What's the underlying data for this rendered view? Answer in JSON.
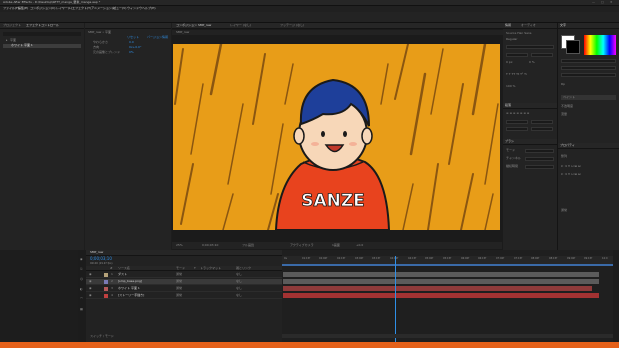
{
  "window": {
    "title": "Adobe After Effects - D:\\Desktop\\SETT_manga_要素_manga.aep *"
  },
  "menu": [
    "ファイル(F)",
    "編集(E)",
    "コンポジション(C)",
    "レイヤー(L)",
    "エフェクト(T)",
    "アニメーション(A)",
    "ビュー(V)",
    "ウィンドウ",
    "ヘルプ(H)"
  ],
  "toolbar": {
    "workspaces": [
      "デフォルト",
      "学ぶ",
      "標準",
      "小画面",
      "ライブラリ"
    ],
    "search_placeholder": "ヘルプを検索"
  },
  "project_panel": {
    "tab": "プロジェクト",
    "tab2": "エフェクトコントロール",
    "items": [
      "平面",
      "ホワイト 平面 1"
    ]
  },
  "effect_controls": {
    "layer": "SMP_raw • 平面",
    "rows": [
      {
        "label": "やわらかさ",
        "value": "0.0"
      },
      {
        "label": "方向",
        "value": "0x+0.0°"
      },
      {
        "label": "元の画像とブレンド",
        "value": "0%"
      }
    ],
    "reset": "リセット",
    "about": "バージョン情報"
  },
  "viewer": {
    "tabs": [
      "コンポジション SMP_raw",
      "レイヤー (なし)",
      "フッテージ (なし)"
    ],
    "breadcrumb": "SMP_raw",
    "shirt_text": "SANZE",
    "controls": {
      "zoom": "25%",
      "timecode": "0;00;03;10",
      "resolution": "フル画質",
      "camera": "アクティブカメラ",
      "views": "1画面",
      "offset": "+0.0"
    }
  },
  "right_panels": {
    "info_tab": "情報",
    "audio_tab": "オーディオ",
    "preview_tab": "プレビュー",
    "properties_tab": "プロパティ",
    "text_tab": "テキスト",
    "paragraph_tab": "段落",
    "character_tab": "文字",
    "brush_tab": "ブラシ",
    "align_label": "整列",
    "font_name": "Source Han Sans",
    "font_style": "Regular",
    "zoom_value": "100 %",
    "value_a": "0 px",
    "value_b": "0 %",
    "keyboard_label": "Rp",
    "paint_label": "ペイント",
    "opacity_label": "不透明度",
    "flow_label": "流量",
    "mode_label": "モード",
    "channel_label": "チャンネル",
    "duration_label": "継続時間",
    "normal": "通常"
  },
  "timeline": {
    "tab": "SMP_raw",
    "timecode": "0;00;03;10",
    "fps": "00100 (29.97 fps)",
    "columns": [
      "#",
      "ソース名",
      "モード",
      "T",
      "トラックマット",
      "親とリンク"
    ],
    "layers": [
      {
        "num": "1",
        "name": "ダスト",
        "mode": "通常",
        "parent": "なし",
        "color": "#b5a27a"
      },
      {
        "num": "2",
        "name": "[smp_base.png]",
        "mode": "通常",
        "parent": "なし",
        "color": "#7a7ab5"
      },
      {
        "num": "3",
        "name": "ホワイト 平面 1",
        "mode": "通常",
        "parent": "なし",
        "color": "#b55a5a"
      },
      {
        "num": "4",
        "name": "[ストーリー手描き]",
        "mode": "通常",
        "parent": "なし",
        "color": "#c04040"
      }
    ],
    "ruler": [
      "0s",
      "01:15f",
      "02:00f",
      "02:15f",
      "03:00f",
      "03:15f",
      "04:00f",
      "04:15f",
      "05:00f",
      "05:15f",
      "06:00f",
      "06:15f",
      "07:00f",
      "07:15f",
      "08:00f",
      "08:15f",
      "09:00f",
      "09:15f",
      "10:0"
    ],
    "playhead": 0.34,
    "bottom": "スイッチ / モード"
  },
  "colors": {
    "accent_blue": "#2f8fe6",
    "status_orange": "#e5611a",
    "comp_bg": "#e39b1c",
    "hoodie": "#e8431e",
    "hair": "#1e3f9a"
  }
}
